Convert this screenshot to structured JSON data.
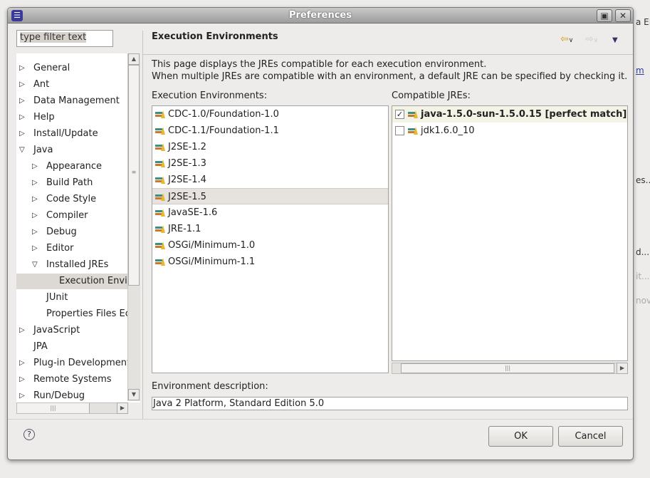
{
  "background": {
    "fragments": [
      "a EE",
      "m",
      "es...",
      "d...",
      "it...",
      "nove"
    ]
  },
  "dialog": {
    "title": "Preferences",
    "filter_placeholder": "type filter text",
    "tree": [
      {
        "label": "General",
        "level": 0,
        "expander": "collapsed"
      },
      {
        "label": "Ant",
        "level": 0,
        "expander": "collapsed"
      },
      {
        "label": "Data Management",
        "level": 0,
        "expander": "collapsed"
      },
      {
        "label": "Help",
        "level": 0,
        "expander": "collapsed"
      },
      {
        "label": "Install/Update",
        "level": 0,
        "expander": "collapsed"
      },
      {
        "label": "Java",
        "level": 0,
        "expander": "expanded"
      },
      {
        "label": "Appearance",
        "level": 1,
        "expander": "collapsed"
      },
      {
        "label": "Build Path",
        "level": 1,
        "expander": "collapsed"
      },
      {
        "label": "Code Style",
        "level": 1,
        "expander": "collapsed"
      },
      {
        "label": "Compiler",
        "level": 1,
        "expander": "collapsed"
      },
      {
        "label": "Debug",
        "level": 1,
        "expander": "collapsed"
      },
      {
        "label": "Editor",
        "level": 1,
        "expander": "collapsed"
      },
      {
        "label": "Installed JREs",
        "level": 1,
        "expander": "expanded"
      },
      {
        "label": "Execution Envi",
        "level": 2,
        "expander": "none",
        "selected": true
      },
      {
        "label": "JUnit",
        "level": 1,
        "expander": "none"
      },
      {
        "label": "Properties Files Ec",
        "level": 1,
        "expander": "none"
      },
      {
        "label": "JavaScript",
        "level": 0,
        "expander": "collapsed"
      },
      {
        "label": "JPA",
        "level": 0,
        "expander": "none"
      },
      {
        "label": "Plug-in Development",
        "level": 0,
        "expander": "collapsed"
      },
      {
        "label": "Remote Systems",
        "level": 0,
        "expander": "collapsed"
      },
      {
        "label": "Run/Debug",
        "level": 0,
        "expander": "collapsed"
      }
    ],
    "page": {
      "title": "Execution Environments",
      "description_line1": "This page displays the JREs compatible for each execution environment.",
      "description_line2": "When multiple JREs are compatible with an environment, a default JRE can be specified by checking it.",
      "environments_label": "Execution Environments:",
      "environments": [
        "CDC-1.0/Foundation-1.0",
        "CDC-1.1/Foundation-1.1",
        "J2SE-1.2",
        "J2SE-1.3",
        "J2SE-1.4",
        "J2SE-1.5",
        "JavaSE-1.6",
        "JRE-1.1",
        "OSGi/Minimum-1.0",
        "OSGi/Minimum-1.1"
      ],
      "selected_environment": "J2SE-1.5",
      "jres_label": "Compatible JREs:",
      "jres": [
        {
          "label": "java-1.5.0-sun-1.5.0.15 [perfect match]",
          "checked": true,
          "bold": true
        },
        {
          "label": "jdk1.6.0_10",
          "checked": false,
          "bold": false
        }
      ],
      "env_description_label": "Environment description:",
      "env_description_value": "Java 2 Platform, Standard Edition 5.0"
    },
    "buttons": {
      "ok": "OK",
      "cancel": "Cancel"
    }
  }
}
